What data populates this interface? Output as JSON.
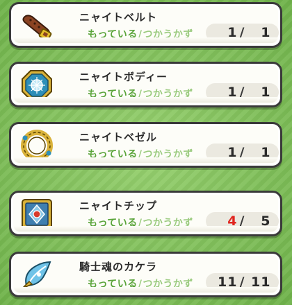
{
  "labels": {
    "have": "もっている",
    "slash": "/",
    "use": "つかうかず",
    "sep": "/"
  },
  "colors": {
    "short": "#e0241e",
    "label_green": "#5aa43a"
  },
  "items": [
    {
      "name": "ニャイトベルト",
      "have": "1",
      "need": "1",
      "icon": "leather-belt-icon"
    },
    {
      "name": "ニャイトボディー",
      "have": "1",
      "need": "1",
      "icon": "octagon-gem-icon"
    },
    {
      "name": "ニャイトベゼル",
      "have": "1",
      "need": "1",
      "icon": "ring-bezel-icon"
    },
    {
      "name": "ニャイトチップ",
      "have": "4",
      "need": "5",
      "icon": "square-chip-icon"
    },
    {
      "name": "騎士魂のカケラ",
      "have": "11",
      "need": "11",
      "icon": "crystal-shard-icon"
    }
  ]
}
